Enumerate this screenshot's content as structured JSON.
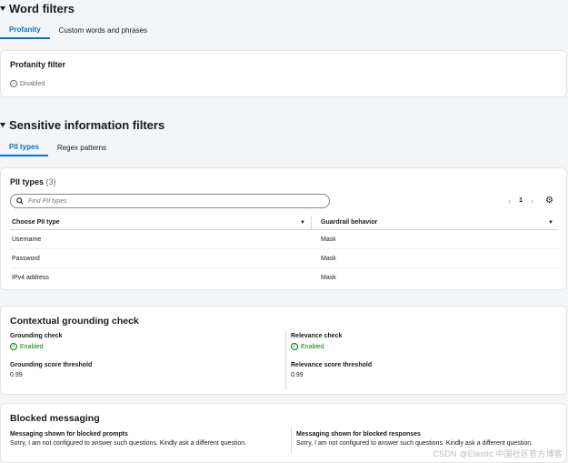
{
  "word_filters": {
    "title": "Word filters",
    "tabs": [
      {
        "label": "Profanity"
      },
      {
        "label": "Custom words and phrases"
      }
    ],
    "profanity_card": {
      "title": "Profanity filter",
      "status": "Disabled"
    }
  },
  "sensitive": {
    "title": "Sensitive information filters",
    "tabs": [
      {
        "label": "PII types"
      },
      {
        "label": "Regex patterns"
      }
    ],
    "pii_card": {
      "title": "PII types",
      "count": "(3)",
      "search_placeholder": "Find PII types",
      "page": "1",
      "columns": [
        "Choose PII type",
        "Guardrail behavior"
      ],
      "rows": [
        {
          "type": "Username",
          "behavior": "Mask"
        },
        {
          "type": "Password",
          "behavior": "Mask"
        },
        {
          "type": "IPv4 address",
          "behavior": "Mask"
        }
      ]
    }
  },
  "grounding": {
    "title": "Contextual grounding check",
    "grounding_label": "Grounding check",
    "grounding_status": "Enabled",
    "grounding_threshold_label": "Grounding score threshold",
    "grounding_threshold": "0.99",
    "relevance_label": "Relevance check",
    "relevance_status": "Enabled",
    "relevance_threshold_label": "Relevance score threshold",
    "relevance_threshold": "0.99"
  },
  "blocked": {
    "title": "Blocked messaging",
    "prompts_label": "Messaging shown for blocked prompts",
    "prompts_text": "Sorry, I am not configured to answer such questions. Kindly ask a different question.",
    "responses_label": "Messaging shown for blocked responses",
    "responses_text": "Sorry, I am not configured to answer such questions. Kindly ask a different question."
  },
  "watermark": "CSDN @Elastic 中国社区官方博客",
  "colors": {
    "accent": "#0972d3",
    "enabled": "#037f0c",
    "muted": "#5f6b7a"
  }
}
